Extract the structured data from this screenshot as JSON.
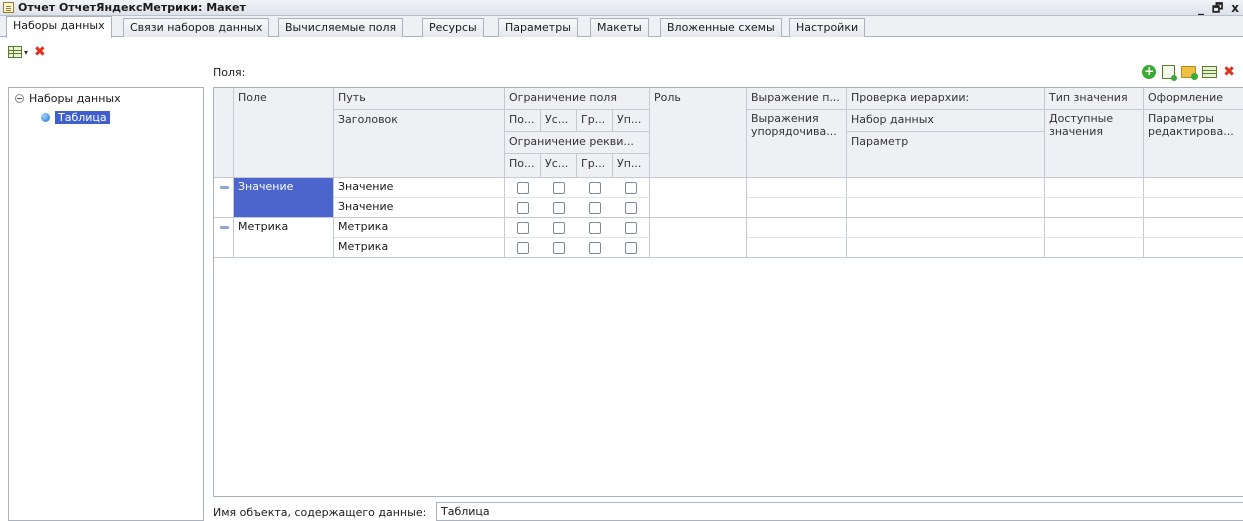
{
  "window": {
    "title": "Отчет ОтчетЯндексМетрики: Макет",
    "minimize": "_",
    "restore": "🗗",
    "close": "x"
  },
  "tabs": [
    {
      "label": "Наборы данных",
      "active": true
    },
    {
      "label": "Связи наборов данных"
    },
    {
      "label": "Вычисляемые поля"
    },
    {
      "label": "Ресурсы"
    },
    {
      "label": "Параметры"
    },
    {
      "label": "Макеты"
    },
    {
      "label": "Вложенные схемы"
    },
    {
      "label": "Настройки"
    }
  ],
  "tree": {
    "root": "Наборы данных",
    "child": "Таблица"
  },
  "fields": {
    "label": "Поля:",
    "headers": {
      "field": "Поле",
      "path": "Путь",
      "title": "Заголовок",
      "field_restriction": "Ограничение поля",
      "restriction_cols": [
        "По...",
        "Ус...",
        "Гр...",
        "Уп..."
      ],
      "attr_restriction": "Ограничение рекви...",
      "attr_restriction_cols": [
        "По...",
        "Ус...",
        "Гр...",
        "Уп..."
      ],
      "role": "Роль",
      "expr_p": "Выражение п...",
      "order_expr": "Выражения упорядочива...",
      "hierarchy_check": "Проверка иерархии:",
      "dataset": "Набор данных",
      "parameter": "Параметр",
      "value_type": "Тип значения",
      "available_values": "Доступные значения",
      "appearance": "Оформление",
      "edit_params": "Параметры редактирова..."
    },
    "rows": [
      {
        "field": "Значение",
        "path": "Значение",
        "title": "Значение",
        "selected": true
      },
      {
        "field": "Метрика",
        "path": "Метрика",
        "title": "Метрика",
        "selected": false
      }
    ]
  },
  "bottom": {
    "label": "Имя объекта, содержащего данные:",
    "value": "Таблица"
  }
}
